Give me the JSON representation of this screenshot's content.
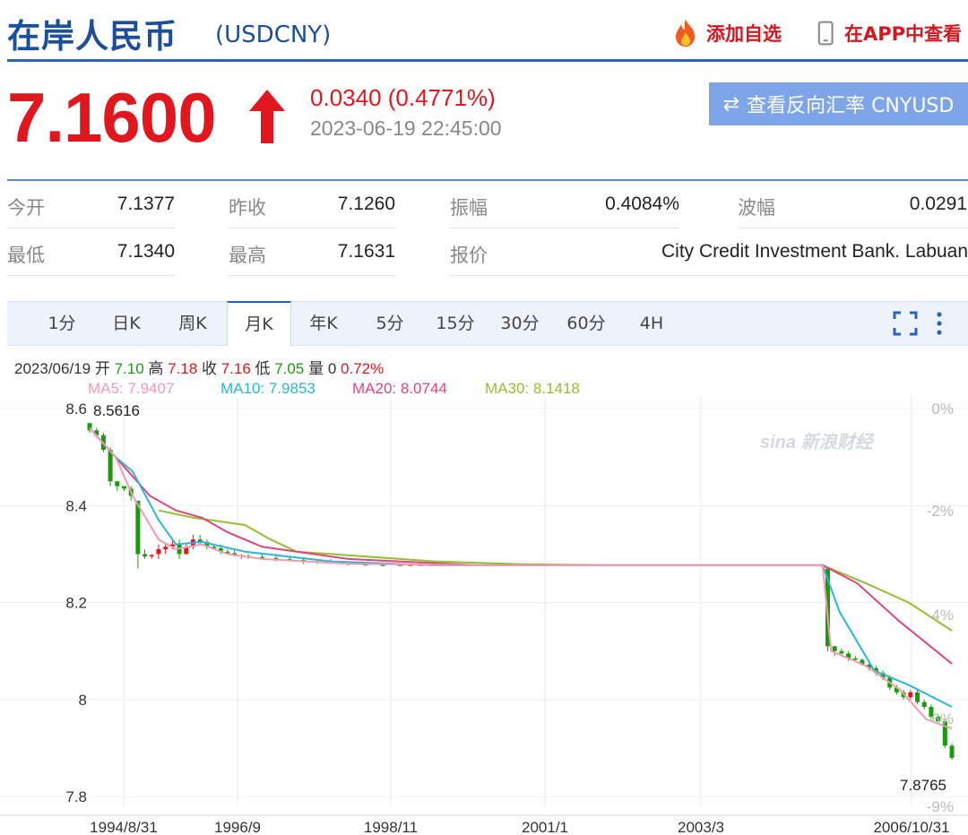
{
  "header": {
    "title": "在岸人民币",
    "code": "(USDCNY)",
    "add_watch": "添加自选",
    "view_app": "在APP中查看"
  },
  "quote": {
    "price": "7.1600",
    "change": "0.0340 (0.4771%)",
    "time": "2023-06-19 22:45:00",
    "reverse_button": "查看反向汇率 CNYUSD"
  },
  "stats": {
    "open_label": "今开",
    "open": "7.1377",
    "prev_close_label": "昨收",
    "prev_close": "7.1260",
    "amplitude_label": "振幅",
    "amplitude": "0.4084%",
    "wave_label": "波幅",
    "wave": "0.0291",
    "low_label": "最低",
    "low": "7.1340",
    "high_label": "最高",
    "high": "7.1631",
    "quote_label": "报价",
    "quoter": "City Credit Investment Bank. Labuan"
  },
  "tabs": [
    "1分",
    "日K",
    "周K",
    "月K",
    "年K",
    "5分",
    "15分",
    "30分",
    "60分",
    "4H"
  ],
  "active_tab": "月K",
  "kline_info": {
    "date": "2023/06/19",
    "open_label": "开",
    "open": "7.10",
    "high_label": "高",
    "high": "7.18",
    "close_label": "收",
    "close": "7.16",
    "low_label": "低",
    "low": "7.05",
    "vol_label": "量",
    "vol": "0",
    "pct": "0.72%"
  },
  "ma": {
    "ma5": "MA5: 7.9407",
    "ma10": "MA10: 7.9853",
    "ma20": "MA20: 8.0744",
    "ma30": "MA30: 8.1418"
  },
  "watermark": "sina 新浪财经",
  "colors": {
    "up": "#e2171d",
    "down": "#1a9b0c",
    "ma5": "#f39ab3",
    "ma10": "#2bb6d6",
    "ma20": "#e0457b",
    "ma30": "#95bf2e",
    "brand": "#1b4f9c"
  },
  "chart_data": {
    "type": "candlestick",
    "y_ticks": [
      "8.6",
      "8.4",
      "8.2",
      "8",
      "7.8"
    ],
    "y_range": [
      7.78,
      8.6
    ],
    "pct_ticks": [
      "0%",
      "-2%",
      "-4%",
      "-6%",
      "-9%"
    ],
    "x_ticks": [
      "1994/8/31",
      "1996/9",
      "1998/11",
      "2001/1",
      "2003/3",
      "2006/10/31"
    ],
    "max_label": "8.5616",
    "min_label": "7.8765",
    "ma_lines": {
      "ma5": [
        [
          0,
          8.56
        ],
        [
          0.03,
          8.5
        ],
        [
          0.05,
          8.42
        ],
        [
          0.08,
          8.33
        ],
        [
          0.1,
          8.31
        ],
        [
          0.13,
          8.32
        ],
        [
          0.16,
          8.3
        ],
        [
          0.2,
          8.29
        ],
        [
          0.3,
          8.28
        ],
        [
          0.45,
          8.277
        ],
        [
          0.6,
          8.277
        ],
        [
          0.85,
          8.277
        ],
        [
          0.86,
          8.1
        ],
        [
          0.9,
          8.07
        ],
        [
          0.94,
          8.02
        ],
        [
          0.97,
          7.96
        ],
        [
          1.0,
          7.94
        ]
      ],
      "ma10": [
        [
          0.0,
          8.56
        ],
        [
          0.03,
          8.5
        ],
        [
          0.05,
          8.47
        ],
        [
          0.08,
          8.37
        ],
        [
          0.1,
          8.32
        ],
        [
          0.13,
          8.325
        ],
        [
          0.18,
          8.305
        ],
        [
          0.28,
          8.285
        ],
        [
          0.4,
          8.277
        ],
        [
          0.6,
          8.277
        ],
        [
          0.85,
          8.277
        ],
        [
          0.87,
          8.18
        ],
        [
          0.91,
          8.06
        ],
        [
          0.95,
          8.03
        ],
        [
          1.0,
          7.985
        ]
      ],
      "ma20": [
        [
          0.0,
          8.56
        ],
        [
          0.05,
          8.46
        ],
        [
          0.07,
          8.42
        ],
        [
          0.1,
          8.39
        ],
        [
          0.13,
          8.375
        ],
        [
          0.16,
          8.345
        ],
        [
          0.2,
          8.315
        ],
        [
          0.3,
          8.29
        ],
        [
          0.45,
          8.277
        ],
        [
          0.6,
          8.277
        ],
        [
          0.85,
          8.277
        ],
        [
          0.89,
          8.24
        ],
        [
          0.94,
          8.16
        ],
        [
          1.0,
          8.074
        ]
      ],
      "ma30": [
        [
          0.08,
          8.39
        ],
        [
          0.12,
          8.375
        ],
        [
          0.18,
          8.36
        ],
        [
          0.21,
          8.33
        ],
        [
          0.24,
          8.305
        ],
        [
          0.32,
          8.295
        ],
        [
          0.4,
          8.285
        ],
        [
          0.5,
          8.279
        ],
        [
          0.6,
          8.277
        ],
        [
          0.85,
          8.277
        ],
        [
          0.9,
          8.24
        ],
        [
          0.95,
          8.2
        ],
        [
          1.0,
          8.142
        ]
      ]
    },
    "candles": [
      {
        "t": 0.0,
        "o": 8.57,
        "h": 8.57,
        "l": 8.55,
        "c": 8.555
      },
      {
        "t": 0.008,
        "o": 8.555,
        "h": 8.56,
        "l": 8.54,
        "c": 8.545
      },
      {
        "t": 0.016,
        "o": 8.545,
        "h": 8.55,
        "l": 8.51,
        "c": 8.515
      },
      {
        "t": 0.024,
        "o": 8.515,
        "h": 8.52,
        "l": 8.44,
        "c": 8.45
      },
      {
        "t": 0.032,
        "o": 8.45,
        "h": 8.45,
        "l": 8.43,
        "c": 8.44
      },
      {
        "t": 0.04,
        "o": 8.44,
        "h": 8.44,
        "l": 8.43,
        "c": 8.435
      },
      {
        "t": 0.048,
        "o": 8.435,
        "h": 8.44,
        "l": 8.41,
        "c": 8.42
      },
      {
        "t": 0.056,
        "o": 8.41,
        "h": 8.41,
        "l": 8.27,
        "c": 8.3
      },
      {
        "t": 0.064,
        "o": 8.3,
        "h": 8.31,
        "l": 8.29,
        "c": 8.295
      },
      {
        "t": 0.072,
        "o": 8.295,
        "h": 8.3,
        "l": 8.29,
        "c": 8.298
      },
      {
        "t": 0.08,
        "o": 8.3,
        "h": 8.32,
        "l": 8.29,
        "c": 8.31
      },
      {
        "t": 0.088,
        "o": 8.31,
        "h": 8.32,
        "l": 8.3,
        "c": 8.315
      },
      {
        "t": 0.096,
        "o": 8.315,
        "h": 8.33,
        "l": 8.31,
        "c": 8.32
      },
      {
        "t": 0.104,
        "o": 8.32,
        "h": 8.33,
        "l": 8.29,
        "c": 8.3
      },
      {
        "t": 0.112,
        "o": 8.3,
        "h": 8.32,
        "l": 8.3,
        "c": 8.315
      },
      {
        "t": 0.12,
        "o": 8.315,
        "h": 8.34,
        "l": 8.31,
        "c": 8.33
      },
      {
        "t": 0.128,
        "o": 8.33,
        "h": 8.34,
        "l": 8.32,
        "c": 8.325
      },
      {
        "t": 0.136,
        "o": 8.325,
        "h": 8.33,
        "l": 8.31,
        "c": 8.315
      },
      {
        "t": 0.144,
        "o": 8.315,
        "h": 8.32,
        "l": 8.31,
        "c": 8.312
      },
      {
        "t": 0.152,
        "o": 8.312,
        "h": 8.32,
        "l": 8.3,
        "c": 8.305
      },
      {
        "t": 0.16,
        "o": 8.305,
        "h": 8.31,
        "l": 8.3,
        "c": 8.302
      },
      {
        "t": 0.168,
        "o": 8.302,
        "h": 8.31,
        "l": 8.295,
        "c": 8.298
      },
      {
        "t": 0.176,
        "o": 8.298,
        "h": 8.3,
        "l": 8.29,
        "c": 8.296
      },
      {
        "t": 0.184,
        "o": 8.296,
        "h": 8.3,
        "l": 8.29,
        "c": 8.294
      },
      {
        "t": 0.2,
        "o": 8.294,
        "h": 8.3,
        "l": 8.29,
        "c": 8.292
      },
      {
        "t": 0.216,
        "o": 8.292,
        "h": 8.3,
        "l": 8.285,
        "c": 8.29
      },
      {
        "t": 0.232,
        "o": 8.29,
        "h": 8.295,
        "l": 8.285,
        "c": 8.288
      },
      {
        "t": 0.248,
        "o": 8.288,
        "h": 8.29,
        "l": 8.28,
        "c": 8.285
      },
      {
        "t": 0.264,
        "o": 8.285,
        "h": 8.29,
        "l": 8.28,
        "c": 8.283
      },
      {
        "t": 0.28,
        "o": 8.283,
        "h": 8.29,
        "l": 8.28,
        "c": 8.281
      },
      {
        "t": 0.3,
        "o": 8.281,
        "h": 8.285,
        "l": 8.277,
        "c": 8.279
      },
      {
        "t": 0.32,
        "o": 8.279,
        "h": 8.282,
        "l": 8.277,
        "c": 8.278
      },
      {
        "t": 0.34,
        "o": 8.278,
        "h": 8.28,
        "l": 8.276,
        "c": 8.277
      },
      {
        "t": 0.85,
        "o": 8.277,
        "h": 8.28,
        "l": 8.27,
        "c": 8.275
      },
      {
        "t": 0.856,
        "o": 8.27,
        "h": 8.27,
        "l": 8.1,
        "c": 8.11
      },
      {
        "t": 0.864,
        "o": 8.11,
        "h": 8.11,
        "l": 8.09,
        "c": 8.1
      },
      {
        "t": 0.872,
        "o": 8.1,
        "h": 8.105,
        "l": 8.09,
        "c": 8.095
      },
      {
        "t": 0.88,
        "o": 8.095,
        "h": 8.1,
        "l": 8.08,
        "c": 8.085
      },
      {
        "t": 0.888,
        "o": 8.085,
        "h": 8.09,
        "l": 8.08,
        "c": 8.082
      },
      {
        "t": 0.896,
        "o": 8.082,
        "h": 8.085,
        "l": 8.07,
        "c": 8.072
      },
      {
        "t": 0.904,
        "o": 8.072,
        "h": 8.08,
        "l": 8.06,
        "c": 8.065
      },
      {
        "t": 0.912,
        "o": 8.065,
        "h": 8.07,
        "l": 8.05,
        "c": 8.055
      },
      {
        "t": 0.92,
        "o": 8.055,
        "h": 8.06,
        "l": 8.04,
        "c": 8.045
      },
      {
        "t": 0.928,
        "o": 8.045,
        "h": 8.05,
        "l": 8.02,
        "c": 8.025
      },
      {
        "t": 0.936,
        "o": 8.025,
        "h": 8.03,
        "l": 8.01,
        "c": 8.015
      },
      {
        "t": 0.944,
        "o": 8.015,
        "h": 8.02,
        "l": 8.0,
        "c": 8.005
      },
      {
        "t": 0.952,
        "o": 8.005,
        "h": 8.02,
        "l": 8.0,
        "c": 8.015
      },
      {
        "t": 0.96,
        "o": 8.015,
        "h": 8.02,
        "l": 7.99,
        "c": 7.995
      },
      {
        "t": 0.968,
        "o": 7.995,
        "h": 8.0,
        "l": 7.98,
        "c": 7.985
      },
      {
        "t": 0.976,
        "o": 7.985,
        "h": 7.99,
        "l": 7.96,
        "c": 7.965
      },
      {
        "t": 0.984,
        "o": 7.965,
        "h": 7.97,
        "l": 7.95,
        "c": 7.955
      },
      {
        "t": 0.992,
        "o": 7.955,
        "h": 7.96,
        "l": 7.9,
        "c": 7.905
      },
      {
        "t": 1.0,
        "o": 7.905,
        "h": 7.91,
        "l": 7.876,
        "c": 7.88
      }
    ]
  }
}
